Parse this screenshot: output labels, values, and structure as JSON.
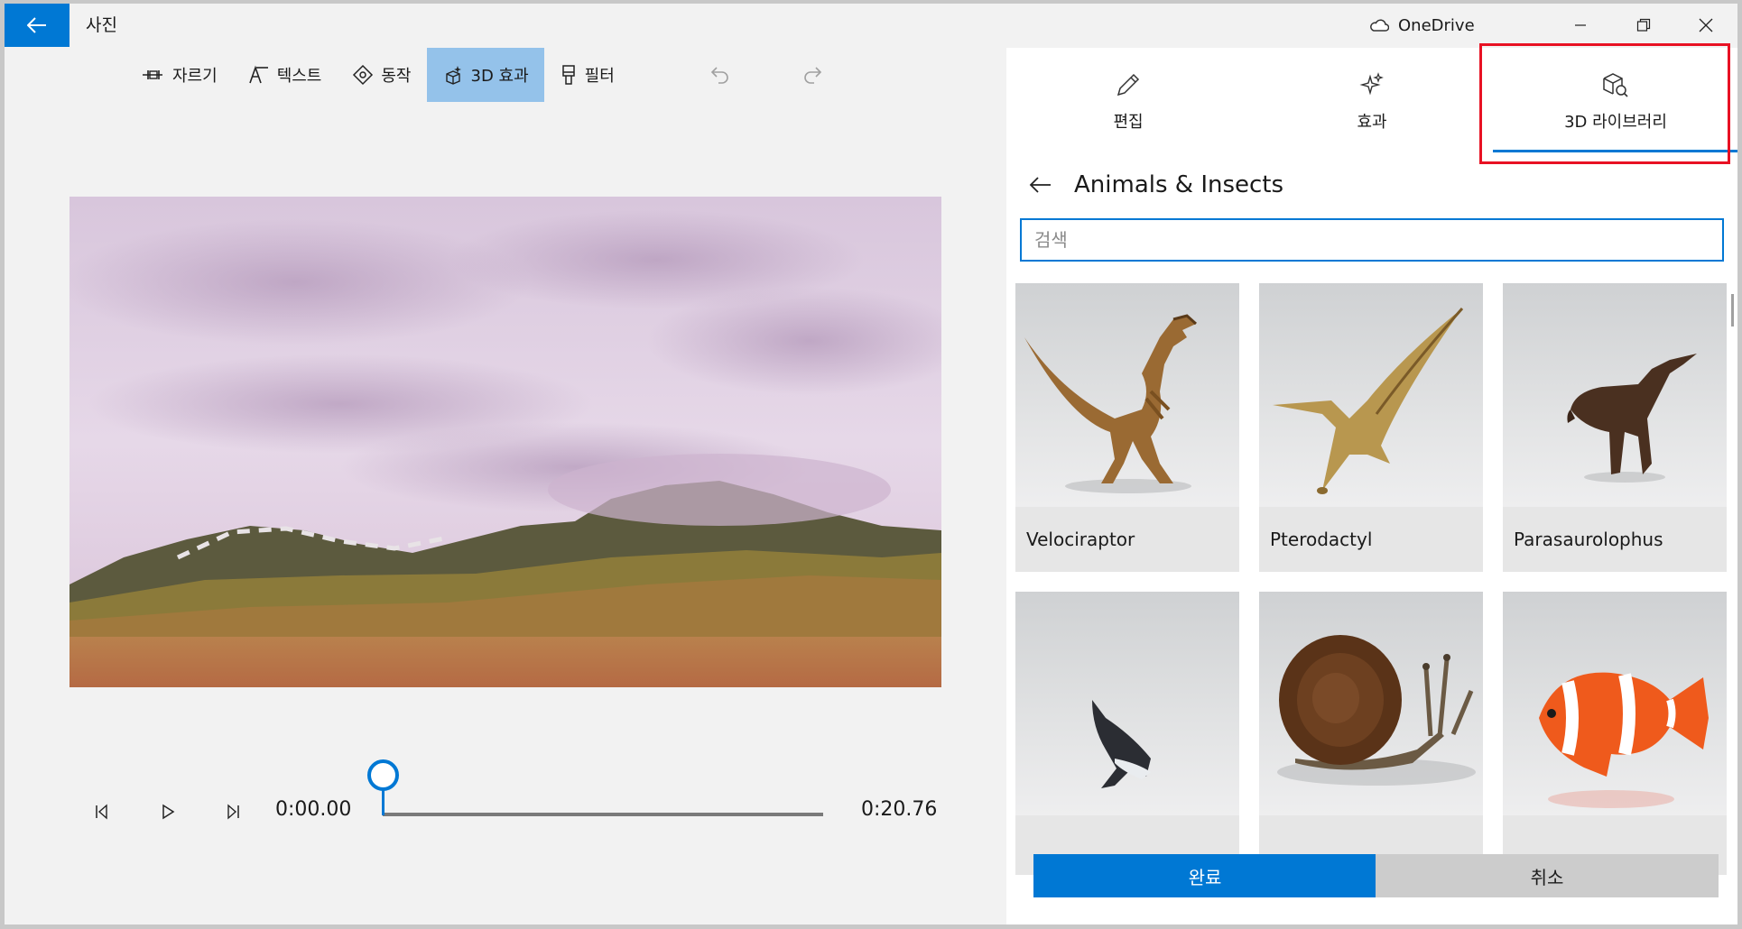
{
  "window": {
    "title": "사진",
    "onedrive_label": "OneDrive"
  },
  "toolbar": {
    "items": [
      {
        "label": "자르기",
        "icon": "trim-icon"
      },
      {
        "label": "텍스트",
        "icon": "text-icon"
      },
      {
        "label": "동작",
        "icon": "motion-icon"
      },
      {
        "label": "3D 효과",
        "icon": "3d-effects-icon",
        "active": true
      },
      {
        "label": "필터",
        "icon": "filter-icon"
      }
    ]
  },
  "playback": {
    "current_time": "0:00.00",
    "total_time": "0:20.76",
    "progress": 0
  },
  "panel": {
    "tabs": [
      {
        "label": "편집",
        "icon": "pencil-icon"
      },
      {
        "label": "효과",
        "icon": "sparkle-icon"
      },
      {
        "label": "3D 라이브러리",
        "icon": "3d-library-icon",
        "selected": true
      }
    ],
    "category_title": "Animals & Insects",
    "search_placeholder": "검색",
    "items": [
      {
        "name": "Velociraptor"
      },
      {
        "name": "Pterodactyl"
      },
      {
        "name": "Parasaurolophus"
      },
      {
        "name": ""
      },
      {
        "name": ""
      },
      {
        "name": ""
      }
    ],
    "done_label": "완료",
    "cancel_label": "취소"
  },
  "colors": {
    "accent": "#0078d4",
    "active_tool": "#94c2ea",
    "highlight": "#e81123"
  }
}
